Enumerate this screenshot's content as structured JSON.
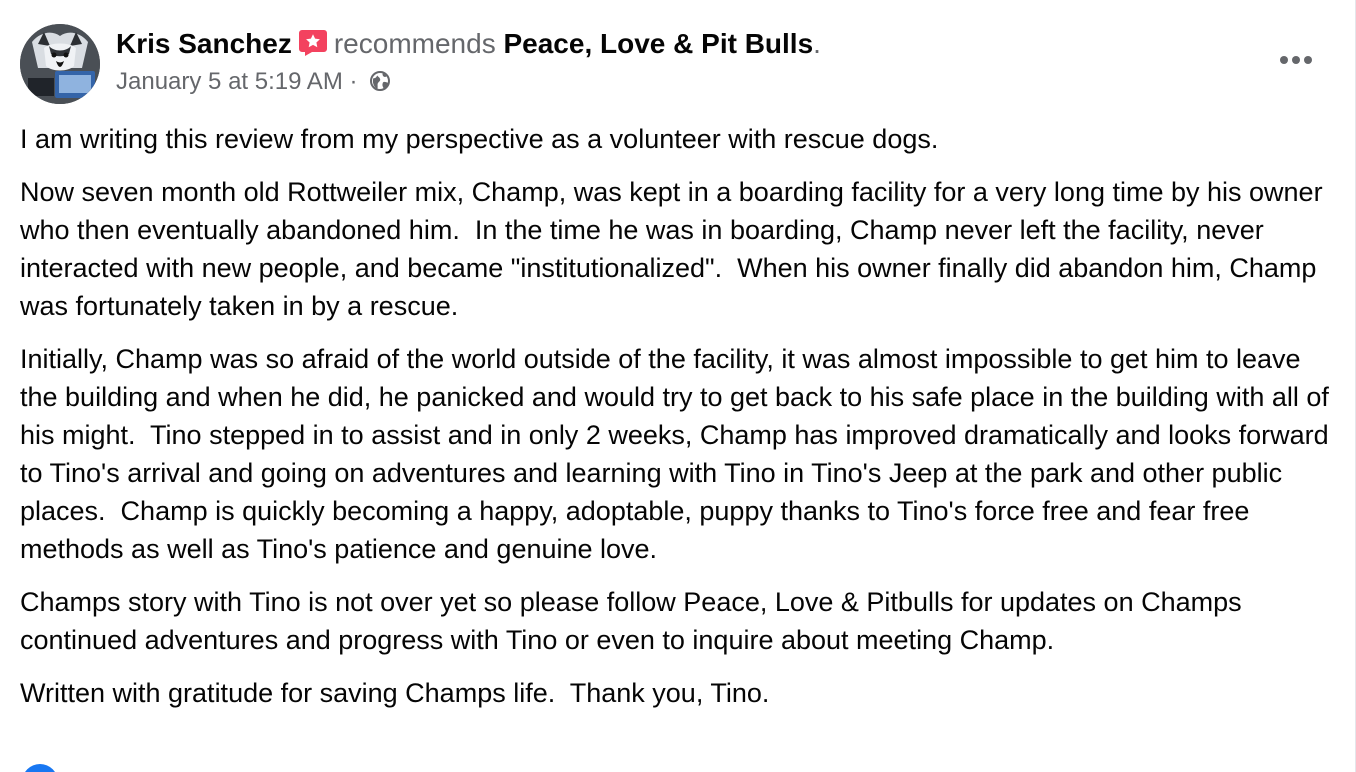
{
  "post": {
    "author": "Kris Sanchez",
    "recommends_text": "recommends",
    "page_name": "Peace, Love & Pit Bulls",
    "period": ".",
    "timestamp": "January 5 at 5:19 AM",
    "separator": "·",
    "privacy_icon": "globe-icon",
    "recommendation_icon": "recommendation-star-icon",
    "more_icon": "more-options-icon",
    "paragraphs": [
      "I am writing this review from my perspective as a volunteer with rescue dogs.",
      "Now seven month old Rottweiler mix, Champ, was kept in a boarding facility for a very long time by his owner who then eventually abandoned him.  In the time he was in boarding, Champ never left the facility, never interacted with new people, and became \"institutionalized\".  When his owner finally did abandon him, Champ was fortunately taken in by a rescue.",
      "Initially, Champ was so afraid of the world outside of the facility, it was almost impossible to get him to leave the building and when he did, he panicked and would try to get back to his safe place in the building with all of his might.  Tino stepped in to assist and in only 2 weeks, Champ has improved dramatically and looks forward to Tino's arrival and going on adventures and learning with Tino in Tino's Jeep at the park and other public places.  Champ is quickly becoming a happy, adoptable, puppy thanks to Tino's force free and fear free methods as well as Tino's patience and genuine love.",
      "Champs story with Tino is not over yet so please follow Peace, Love & Pitbulls for updates on Champs continued adventures and progress with Tino or even to inquire about meeting Champ.",
      "Written with gratitude for saving Champs life.  Thank you, Tino."
    ]
  },
  "colors": {
    "primary_text": "#050505",
    "secondary_text": "#65676b",
    "recommend_badge": "#f3425f",
    "facebook_blue": "#1877f2"
  }
}
